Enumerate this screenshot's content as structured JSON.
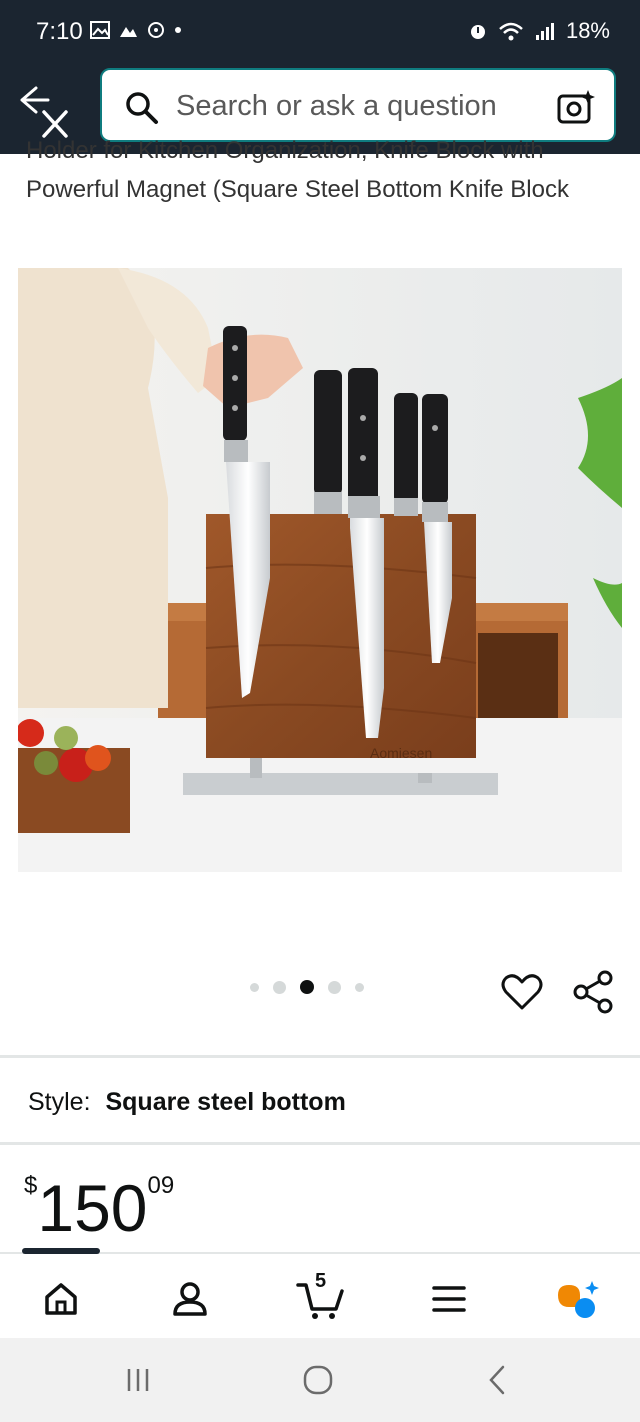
{
  "status_bar": {
    "time": "7:10",
    "battery": "18%"
  },
  "search": {
    "placeholder": "Search or ask a question"
  },
  "product": {
    "title_partial": "Holder for Kitchen Organization, Knife Block with",
    "title_line2": "Powerful Magnet (Square Steel Bottom Knife Block",
    "image_brand_text": "Aomiesen",
    "carousel": {
      "count": 5,
      "active_index": 2
    },
    "style_label": "Style:",
    "style_value": "Square steel bottom",
    "price_symbol": "$",
    "price_whole": "150",
    "price_fraction": "09"
  },
  "bottom_nav": {
    "items": [
      {
        "name": "home",
        "icon": "home-icon"
      },
      {
        "name": "account",
        "icon": "person-icon"
      },
      {
        "name": "cart",
        "icon": "cart-icon",
        "badge": "5"
      },
      {
        "name": "menu",
        "icon": "menu-icon"
      },
      {
        "name": "rufus",
        "icon": "rufus-icon"
      }
    ]
  },
  "colors": {
    "header_bg": "#1b2530",
    "search_border": "#0f7c7f",
    "accent_orange": "#f08804",
    "accent_blue": "#0a8df2"
  }
}
